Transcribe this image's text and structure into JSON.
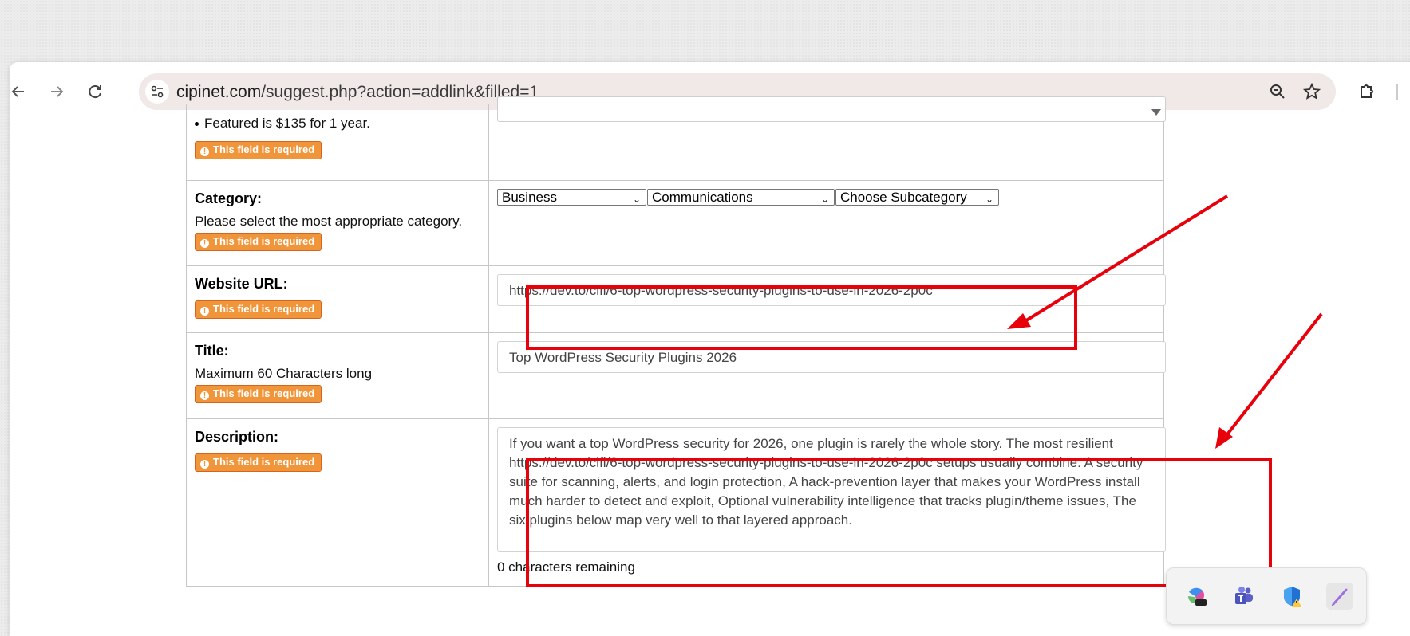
{
  "browser": {
    "url_domain": "cipinet.com",
    "url_path": "/suggest.php?action=addlink&filled=1",
    "icons": [
      "back-icon",
      "forward-icon",
      "reload-icon",
      "site-settings-icon",
      "zoom-icon",
      "bookmark-star-icon",
      "extensions-icon"
    ]
  },
  "form": {
    "required_label": "This field is required",
    "featured": {
      "text": "Featured is $135 for 1 year."
    },
    "category": {
      "label": "Category:",
      "help": "Please select the most appropriate category.",
      "select1": "Business",
      "select2": "Communications",
      "select3": "Choose Subcategory"
    },
    "website_url": {
      "label": "Website URL:",
      "value": "https://dev.to/cifi/6-top-wordpress-security-plugins-to-use-in-2026-2p0c"
    },
    "title": {
      "label": "Title:",
      "help": "Maximum 60 Characters long",
      "value": "Top WordPress Security Plugins 2026"
    },
    "description": {
      "label": "Description:",
      "value": "If you want a top WordPress security for 2026, one plugin is rarely the whole story. The most resilient https://dev.to/cifi/6-top-wordpress-security-plugins-to-use-in-2026-2p0c  setups usually combine: A security suite for scanning, alerts, and login protection, A hack-prevention layer that makes your WordPress install much harder to detect and exploit, Optional vulnerability intelligence that tracks plugin/theme issues, The six plugins below map very well to that layered approach.",
      "remaining": "0 characters remaining"
    }
  },
  "annotations": {
    "color": "#e8000b"
  },
  "tray": {
    "icons": [
      "copilot-365-icon",
      "teams-icon",
      "defender-shield-icon",
      "pen-icon"
    ]
  }
}
